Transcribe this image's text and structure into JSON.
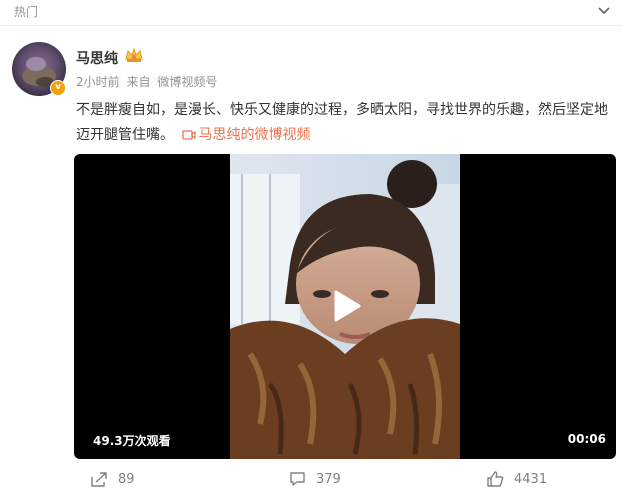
{
  "section": {
    "title": "热门"
  },
  "post": {
    "author": "马思纯",
    "time": "2小时前",
    "source_prefix": "来自",
    "source": "微博视频号",
    "text": "不是胖瘦自如，是漫长、快乐又健康的过程，多晒太阳，寻找世界的乐趣，然后坚定地迈开腿管住嘴。",
    "video_link_text": "马思纯的微博视频"
  },
  "video": {
    "views": "49.3万次观看",
    "duration": "00:06"
  },
  "actions": {
    "share_count": "89",
    "comment_count": "379",
    "like_count": "4431"
  },
  "colors": {
    "accent": "#eb7350",
    "verified": "#f5a200",
    "muted": "#939393"
  },
  "icons": [
    "chevron-down-icon",
    "avatar",
    "verified-icon",
    "member-crown-icon",
    "video-link-icon",
    "play-icon",
    "share-icon",
    "comment-icon",
    "like-icon"
  ]
}
